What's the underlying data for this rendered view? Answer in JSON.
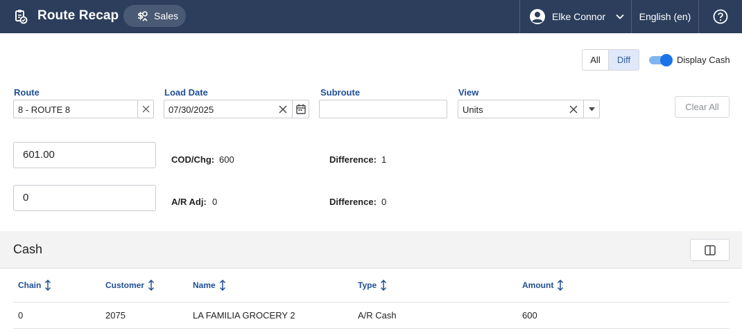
{
  "header": {
    "title": "Route Recap",
    "module": "Sales",
    "user_name": "Elke Connor",
    "language": "English (en)"
  },
  "view_toggle": {
    "all_label": "All",
    "diff_label": "Diff",
    "selected": "Diff"
  },
  "display_cash": {
    "label": "Display Cash",
    "on": true
  },
  "filters": {
    "route": {
      "label": "Route",
      "value": "8 - ROUTE 8"
    },
    "load_date": {
      "label": "Load Date",
      "value": "07/30/2025"
    },
    "subroute": {
      "label": "Subroute",
      "value": ""
    },
    "view": {
      "label": "View",
      "value": "Units"
    },
    "clear_all": "Clear All"
  },
  "cash_summary": {
    "cod_input": "601.00",
    "cod_label": "COD/Chg:",
    "cod_value": "600",
    "cod_diff_label": "Difference:",
    "cod_diff_value": "1",
    "ar_input": "0",
    "ar_label": "A/R Adj:",
    "ar_value": "0",
    "ar_diff_label": "Difference:",
    "ar_diff_value": "0"
  },
  "cash_section": {
    "title": "Cash",
    "columns": [
      "Chain",
      "Customer",
      "Name",
      "Type",
      "Amount"
    ],
    "rows": [
      [
        "0",
        "2075",
        "LA FAMILIA GROCERY 2",
        "A/R Cash",
        "600"
      ]
    ]
  },
  "colors": {
    "header_bg": "#2c3e5c",
    "accent": "#1f4e96",
    "toggle_on": "#1a73e8"
  }
}
